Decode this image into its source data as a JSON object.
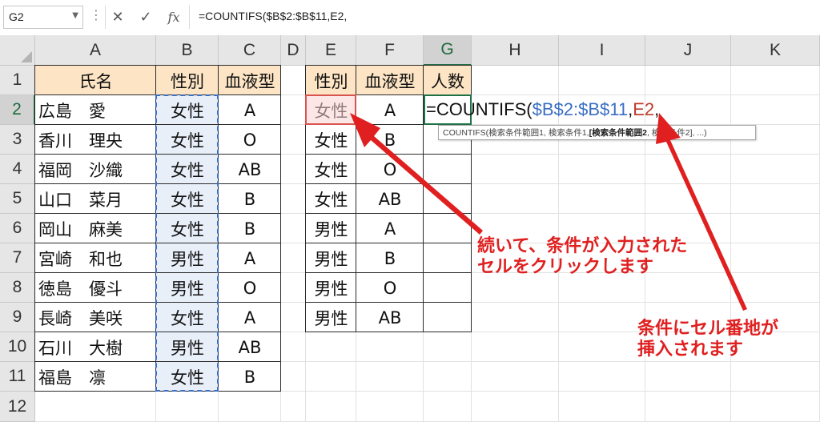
{
  "formula_bar": {
    "name_box": "G2",
    "dots": "⋮",
    "cancel_icon": "✕",
    "enter_icon": "✓",
    "fx_icon": "fx",
    "formula": "=COUNTIFS($B$2:$B$11,E2,"
  },
  "columns": [
    "A",
    "B",
    "C",
    "D",
    "E",
    "F",
    "G",
    "H",
    "I",
    "J",
    "K"
  ],
  "rows": [
    "1",
    "2",
    "3",
    "4",
    "5",
    "6",
    "7",
    "8",
    "9",
    "10",
    "11",
    "12"
  ],
  "table1": {
    "headers": [
      "氏名",
      "性別",
      "血液型"
    ],
    "rows": [
      [
        "広島　愛",
        "女性",
        "A"
      ],
      [
        "香川　理央",
        "女性",
        "O"
      ],
      [
        "福岡　沙織",
        "女性",
        "AB"
      ],
      [
        "山口　菜月",
        "女性",
        "B"
      ],
      [
        "岡山　麻美",
        "女性",
        "B"
      ],
      [
        "宮崎　和也",
        "男性",
        "A"
      ],
      [
        "徳島　優斗",
        "男性",
        "O"
      ],
      [
        "長崎　美咲",
        "女性",
        "A"
      ],
      [
        "石川　大樹",
        "男性",
        "AB"
      ],
      [
        "福島　凛",
        "女性",
        "B"
      ]
    ]
  },
  "table2": {
    "headers": [
      "性別",
      "血液型",
      "人数"
    ],
    "rows": [
      [
        "女性",
        "A"
      ],
      [
        "女性",
        "B"
      ],
      [
        "女性",
        "O"
      ],
      [
        "女性",
        "AB"
      ],
      [
        "男性",
        "A"
      ],
      [
        "男性",
        "B"
      ],
      [
        "男性",
        "O"
      ],
      [
        "男性",
        "AB"
      ]
    ]
  },
  "editing": {
    "formula_prefix": "=COUNTIFS(",
    "range_ref": "$B$2:$B$11",
    "comma1": ",",
    "cell_ref": "E2",
    "comma2": ","
  },
  "tooltip": {
    "prefix": "COUNTIFS(検索条件範囲1, 検索条件1, ",
    "bold": "[検索条件範囲2",
    "suffix": ", 検索条件2], ...)"
  },
  "annotations": {
    "note1_line1": "続いて、条件が入力された",
    "note1_line2": "セルをクリックします",
    "note2_line1": "条件にセル番地が",
    "note2_line2": "挿入されます"
  },
  "colors": {
    "header_fill": "#fce4c4",
    "range_fill": "#e9eff9",
    "range_ref": "#3a6fc4",
    "cell_ref": "#c0392b",
    "annotation": "#e02020",
    "active": "#1e7145"
  }
}
